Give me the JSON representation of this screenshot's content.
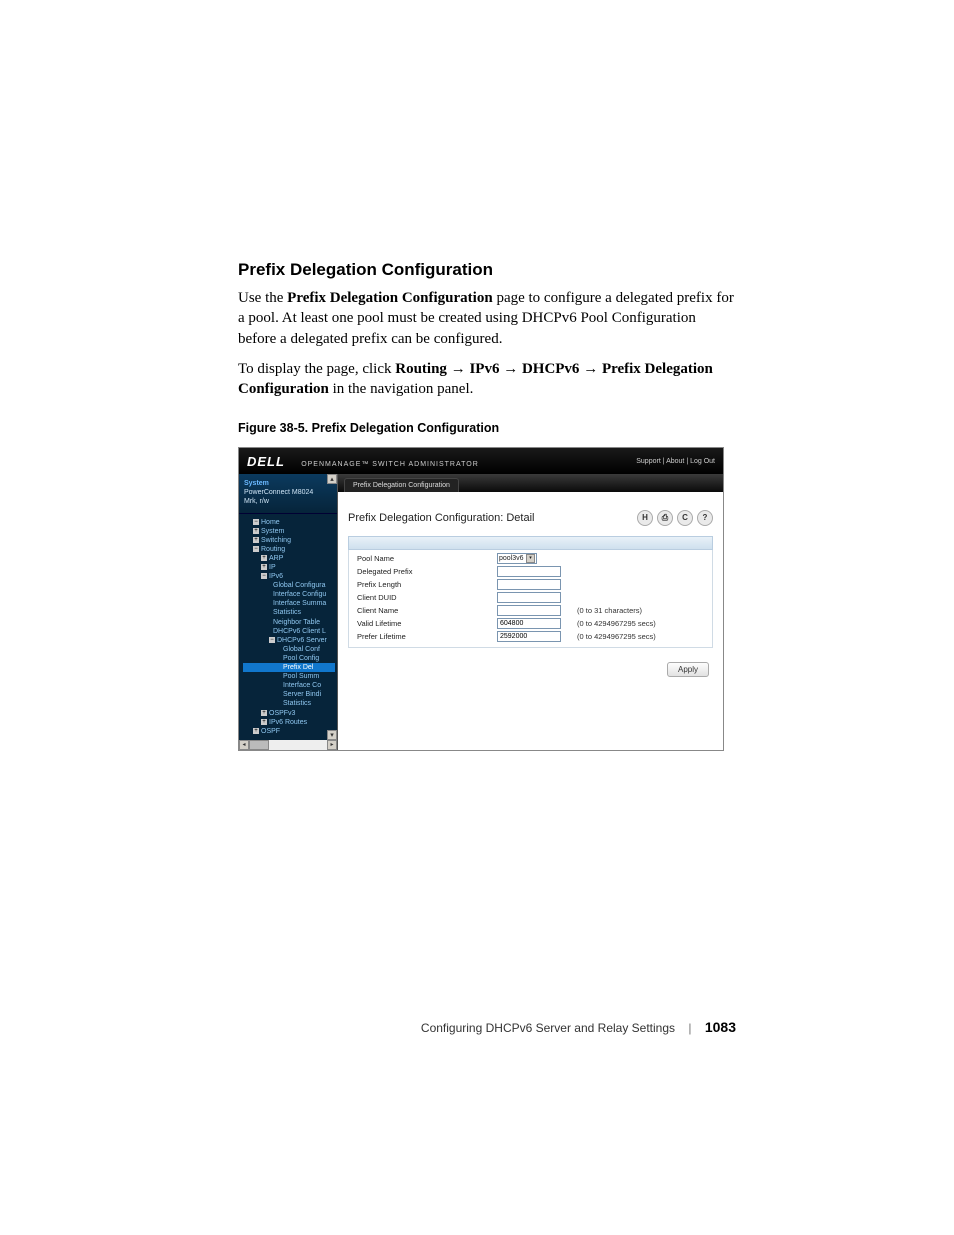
{
  "doc": {
    "section_title": "Prefix Delegation Configuration",
    "p1_a": "Use the ",
    "p1_b": "Prefix Delegation Configuration",
    "p1_c": " page to configure a delegated prefix for a pool. At least one pool must be created using DHCPv6 Pool Configuration before a delegated prefix can be configured.",
    "p2_a": "To display the page, click ",
    "p2_b": "Routing",
    "p2_c": "IPv6",
    "p2_d": "DHCPv6",
    "p2_e": "Prefix Delegation Configuration",
    "p2_f": " in the navigation panel.",
    "figcap": "Figure 38-5.    Prefix Delegation Configuration",
    "footer_title": "Configuring DHCPv6 Server and Relay Settings",
    "page_number": "1083"
  },
  "ui": {
    "brand": "DELL",
    "brand_sub": "OPENMANAGE™ SWITCH ADMINISTRATOR",
    "toplinks": "Support  |  About  |  Log Out",
    "sidebar": {
      "system": "System",
      "device": "PowerConnect M8024",
      "link": "Mrk, r/w",
      "items": [
        "Home",
        "System",
        "Switching",
        "Routing",
        "ARP",
        "IP",
        "IPv6",
        "Global Configura",
        "Interface Configu",
        "Interface Summa",
        "Statistics",
        "Neighbor Table",
        "DHCPv6 Client L",
        "DHCPv6 Server",
        "Global Conf",
        "Pool Config",
        "Prefix Del",
        "Pool Summ",
        "Interface Co",
        "Server Bindi",
        "Statistics",
        "OSPFv3",
        "IPv6 Routes",
        "OSPF"
      ]
    },
    "tab": "Prefix Delegation Configuration",
    "panel_title": "Prefix Delegation Configuration: Detail",
    "fields": {
      "pool_name_label": "Pool Name",
      "pool_name_value": "pool3v6",
      "delegated_prefix_label": "Delegated Prefix",
      "prefix_length_label": "Prefix Length",
      "client_duid_label": "Client DUID",
      "client_name_label": "Client Name",
      "client_name_hint": "(0 to 31 characters)",
      "valid_lifetime_label": "Valid Lifetime",
      "valid_lifetime_value": "604800",
      "valid_lifetime_hint": "(0 to 4294967295 secs)",
      "prefer_lifetime_label": "Prefer Lifetime",
      "prefer_lifetime_value": "2592000",
      "prefer_lifetime_hint": "(0 to 4294967295 secs)"
    },
    "apply": "Apply"
  }
}
